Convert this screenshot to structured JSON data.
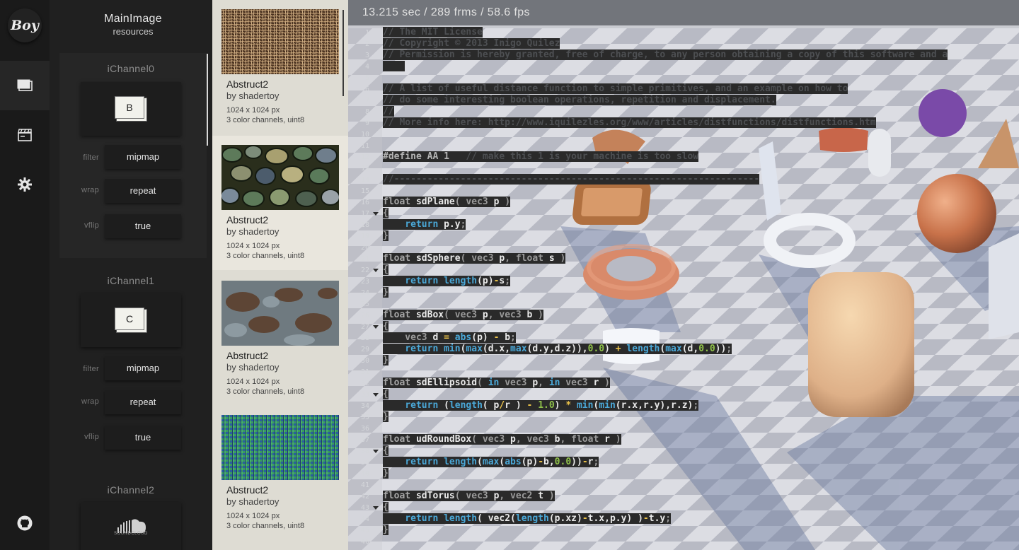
{
  "app": {
    "logo": "Boy"
  },
  "rail": {
    "items": [
      {
        "name": "resources",
        "icon": "layers-icon",
        "active": true
      },
      {
        "name": "media",
        "icon": "clapperboard-icon",
        "active": false
      },
      {
        "name": "settings",
        "icon": "gear-icon",
        "active": false
      }
    ],
    "github_icon": "github-icon"
  },
  "channels_panel": {
    "title": "MainImage",
    "subtitle": "resources",
    "channels": [
      {
        "label": "iChannel0",
        "key": "B",
        "filter_label": "filter",
        "filter": "mipmap",
        "wrap_label": "wrap",
        "wrap": "repeat",
        "vflip_label": "vflip",
        "vflip": "true"
      },
      {
        "label": "iChannel1",
        "key": "C",
        "filter_label": "filter",
        "filter": "mipmap",
        "wrap_label": "wrap",
        "wrap": "repeat",
        "vflip_label": "vflip",
        "vflip": "true"
      },
      {
        "label": "iChannel2",
        "source": "SOUNDCLOUD",
        "source_icon": "soundcloud-icon"
      }
    ]
  },
  "textures": [
    {
      "name": "Abstruct2",
      "author": "by shadertoy",
      "size": "1024 x 1024 px",
      "channels": "3 color channels, uint8",
      "selected": false,
      "thumb": "woven-fibers"
    },
    {
      "name": "Abstruct2",
      "author": "by shadertoy",
      "size": "1024 x 1024 px",
      "channels": "3 color channels, uint8",
      "selected": true,
      "thumb": "pebbles"
    },
    {
      "name": "Abstruct2",
      "author": "by shadertoy",
      "size": "1024 x 1024 px",
      "channels": "3 color channels, uint8",
      "selected": false,
      "thumb": "rusty-stone"
    },
    {
      "name": "Abstruct2",
      "author": "by shadertoy",
      "size": "1024 x 1024 px",
      "channels": "3 color channels, uint8",
      "selected": false,
      "thumb": "green-noise"
    }
  ],
  "viewport": {
    "stats": "13.215 sec / 289 frms / 58.6 fps",
    "colors": {
      "accent_blue": "#4aa8d8",
      "number_green": "#8fc04a",
      "operator_yellow": "#f0c64a"
    }
  },
  "editor": {
    "folds": [
      17,
      22,
      27,
      33,
      38,
      43
    ],
    "lines": [
      [
        {
          "c": "cmt",
          "t": "// The MIT License"
        }
      ],
      [
        {
          "c": "cmt",
          "t": "// Copyright © 2013 Inigo Quilez"
        }
      ],
      [
        {
          "c": "cmt",
          "t": "// Permission is hereby granted, free of charge, to any person obtaining a copy of this software and a"
        }
      ],
      [
        {
          "c": "cmt",
          "t": "    "
        }
      ],
      [],
      [
        {
          "c": "cmt",
          "t": "// A list of useful distance function to simple primitives, and an example on how to"
        }
      ],
      [
        {
          "c": "cmt",
          "t": "// do some interesting boolean operations, repetition and displacement."
        }
      ],
      [
        {
          "c": "cmt",
          "t": "//"
        }
      ],
      [
        {
          "c": "cmt",
          "t": "// More info here: http://www.iquilezles.org/www/articles/distfunctions/distfunctions.htm"
        }
      ],
      [],
      [],
      [
        {
          "c": "def",
          "t": "#define AA 1"
        },
        {
          "c": "cmt",
          "t": "   // make this 1 is your machine is too slow"
        }
      ],
      [],
      [
        {
          "c": "cmt",
          "t": "//------------------------------------------------------------------"
        }
      ],
      [],
      [
        {
          "c": "typ",
          "t": "float"
        },
        {
          "c": "fn",
          "t": " sdPlane"
        },
        {
          "c": "kw",
          "t": "( vec3 "
        },
        {
          "c": "fn",
          "t": "p"
        },
        {
          "c": "kw",
          "t": " )"
        }
      ],
      [
        {
          "c": "kw",
          "t": "{"
        }
      ],
      [
        {
          "c": "kw",
          "t": "    "
        },
        {
          "c": "bi",
          "t": "return"
        },
        {
          "c": "fn",
          "t": " p.y"
        },
        {
          "c": "kw",
          "t": ";"
        }
      ],
      [
        {
          "c": "kw",
          "t": "}"
        }
      ],
      [],
      [
        {
          "c": "typ",
          "t": "float"
        },
        {
          "c": "fn",
          "t": " sdSphere"
        },
        {
          "c": "kw",
          "t": "( vec3 "
        },
        {
          "c": "fn",
          "t": "p"
        },
        {
          "c": "kw",
          "t": ", float "
        },
        {
          "c": "fn",
          "t": "s"
        },
        {
          "c": "kw",
          "t": " )"
        }
      ],
      [
        {
          "c": "kw",
          "t": "{"
        }
      ],
      [
        {
          "c": "kw",
          "t": "    "
        },
        {
          "c": "bi",
          "t": "return"
        },
        {
          "c": "fn",
          "t": " "
        },
        {
          "c": "bi",
          "t": "length"
        },
        {
          "c": "fn",
          "t": "(p)"
        },
        {
          "c": "op",
          "t": "-"
        },
        {
          "c": "fn",
          "t": "s"
        },
        {
          "c": "kw",
          "t": ";"
        }
      ],
      [
        {
          "c": "kw",
          "t": "}"
        }
      ],
      [],
      [
        {
          "c": "typ",
          "t": "float"
        },
        {
          "c": "fn",
          "t": " sdBox"
        },
        {
          "c": "kw",
          "t": "( vec3 "
        },
        {
          "c": "fn",
          "t": "p"
        },
        {
          "c": "kw",
          "t": ", vec3 "
        },
        {
          "c": "fn",
          "t": "b"
        },
        {
          "c": "kw",
          "t": " )"
        }
      ],
      [
        {
          "c": "kw",
          "t": "{"
        }
      ],
      [
        {
          "c": "kw",
          "t": "    vec3 "
        },
        {
          "c": "fn",
          "t": "d "
        },
        {
          "c": "op",
          "t": "="
        },
        {
          "c": "fn",
          "t": " "
        },
        {
          "c": "bi",
          "t": "abs"
        },
        {
          "c": "fn",
          "t": "(p) "
        },
        {
          "c": "op",
          "t": "-"
        },
        {
          "c": "fn",
          "t": " b"
        },
        {
          "c": "kw",
          "t": ";"
        }
      ],
      [
        {
          "c": "kw",
          "t": "    "
        },
        {
          "c": "bi",
          "t": "return"
        },
        {
          "c": "fn",
          "t": " "
        },
        {
          "c": "bi",
          "t": "min"
        },
        {
          "c": "fn",
          "t": "("
        },
        {
          "c": "bi",
          "t": "max"
        },
        {
          "c": "fn",
          "t": "(d.x,"
        },
        {
          "c": "bi",
          "t": "max"
        },
        {
          "c": "fn",
          "t": "(d.y,d.z)),"
        },
        {
          "c": "num",
          "t": "0.0"
        },
        {
          "c": "fn",
          "t": ") "
        },
        {
          "c": "op",
          "t": "+"
        },
        {
          "c": "fn",
          "t": " "
        },
        {
          "c": "bi",
          "t": "length"
        },
        {
          "c": "fn",
          "t": "("
        },
        {
          "c": "bi",
          "t": "max"
        },
        {
          "c": "fn",
          "t": "(d,"
        },
        {
          "c": "num",
          "t": "0.0"
        },
        {
          "c": "fn",
          "t": "))"
        },
        {
          "c": "kw",
          "t": ";"
        }
      ],
      [
        {
          "c": "kw",
          "t": "}"
        }
      ],
      [],
      [
        {
          "c": "typ",
          "t": "float"
        },
        {
          "c": "fn",
          "t": " sdEllipsoid"
        },
        {
          "c": "kw",
          "t": "( "
        },
        {
          "c": "bi",
          "t": "in"
        },
        {
          "c": "kw",
          "t": " vec3 "
        },
        {
          "c": "fn",
          "t": "p"
        },
        {
          "c": "kw",
          "t": ", "
        },
        {
          "c": "bi",
          "t": "in"
        },
        {
          "c": "kw",
          "t": " vec3 "
        },
        {
          "c": "fn",
          "t": "r"
        },
        {
          "c": "kw",
          "t": " )"
        }
      ],
      [
        {
          "c": "kw",
          "t": "{"
        }
      ],
      [
        {
          "c": "kw",
          "t": "    "
        },
        {
          "c": "bi",
          "t": "return"
        },
        {
          "c": "fn",
          "t": " ("
        },
        {
          "c": "bi",
          "t": "length"
        },
        {
          "c": "fn",
          "t": "( p"
        },
        {
          "c": "op",
          "t": "/"
        },
        {
          "c": "fn",
          "t": "r ) "
        },
        {
          "c": "op",
          "t": "-"
        },
        {
          "c": "fn",
          "t": " "
        },
        {
          "c": "num",
          "t": "1.0"
        },
        {
          "c": "fn",
          "t": ") "
        },
        {
          "c": "op",
          "t": "*"
        },
        {
          "c": "fn",
          "t": " "
        },
        {
          "c": "bi",
          "t": "min"
        },
        {
          "c": "fn",
          "t": "("
        },
        {
          "c": "bi",
          "t": "min"
        },
        {
          "c": "fn",
          "t": "(r.x,r.y),r.z)"
        },
        {
          "c": "kw",
          "t": ";"
        }
      ],
      [
        {
          "c": "kw",
          "t": "}"
        }
      ],
      [],
      [
        {
          "c": "typ",
          "t": "float"
        },
        {
          "c": "fn",
          "t": " udRoundBox"
        },
        {
          "c": "kw",
          "t": "( vec3 "
        },
        {
          "c": "fn",
          "t": "p"
        },
        {
          "c": "kw",
          "t": ", vec3 "
        },
        {
          "c": "fn",
          "t": "b"
        },
        {
          "c": "kw",
          "t": ", float "
        },
        {
          "c": "fn",
          "t": "r"
        },
        {
          "c": "kw",
          "t": " )"
        }
      ],
      [
        {
          "c": "kw",
          "t": "{"
        }
      ],
      [
        {
          "c": "kw",
          "t": "    "
        },
        {
          "c": "bi",
          "t": "return"
        },
        {
          "c": "fn",
          "t": " "
        },
        {
          "c": "bi",
          "t": "length"
        },
        {
          "c": "fn",
          "t": "("
        },
        {
          "c": "bi",
          "t": "max"
        },
        {
          "c": "fn",
          "t": "("
        },
        {
          "c": "bi",
          "t": "abs"
        },
        {
          "c": "fn",
          "t": "(p)"
        },
        {
          "c": "op",
          "t": "-"
        },
        {
          "c": "fn",
          "t": "b,"
        },
        {
          "c": "num",
          "t": "0.0"
        },
        {
          "c": "fn",
          "t": "))"
        },
        {
          "c": "op",
          "t": "-"
        },
        {
          "c": "fn",
          "t": "r"
        },
        {
          "c": "kw",
          "t": ";"
        }
      ],
      [
        {
          "c": "kw",
          "t": "}"
        }
      ],
      [],
      [
        {
          "c": "typ",
          "t": "float"
        },
        {
          "c": "fn",
          "t": " sdTorus"
        },
        {
          "c": "kw",
          "t": "( vec3 "
        },
        {
          "c": "fn",
          "t": "p"
        },
        {
          "c": "kw",
          "t": ", vec2 "
        },
        {
          "c": "fn",
          "t": "t"
        },
        {
          "c": "kw",
          "t": " )"
        }
      ],
      [
        {
          "c": "kw",
          "t": "{"
        }
      ],
      [
        {
          "c": "kw",
          "t": "    "
        },
        {
          "c": "bi",
          "t": "return"
        },
        {
          "c": "fn",
          "t": " "
        },
        {
          "c": "bi",
          "t": "length"
        },
        {
          "c": "fn",
          "t": "( vec2("
        },
        {
          "c": "bi",
          "t": "length"
        },
        {
          "c": "fn",
          "t": "(p.xz)"
        },
        {
          "c": "op",
          "t": "-"
        },
        {
          "c": "fn",
          "t": "t.x,p.y) )"
        },
        {
          "c": "op",
          "t": "-"
        },
        {
          "c": "fn",
          "t": "t.y"
        },
        {
          "c": "kw",
          "t": ";"
        }
      ],
      [
        {
          "c": "kw",
          "t": "}"
        }
      ],
      []
    ]
  }
}
